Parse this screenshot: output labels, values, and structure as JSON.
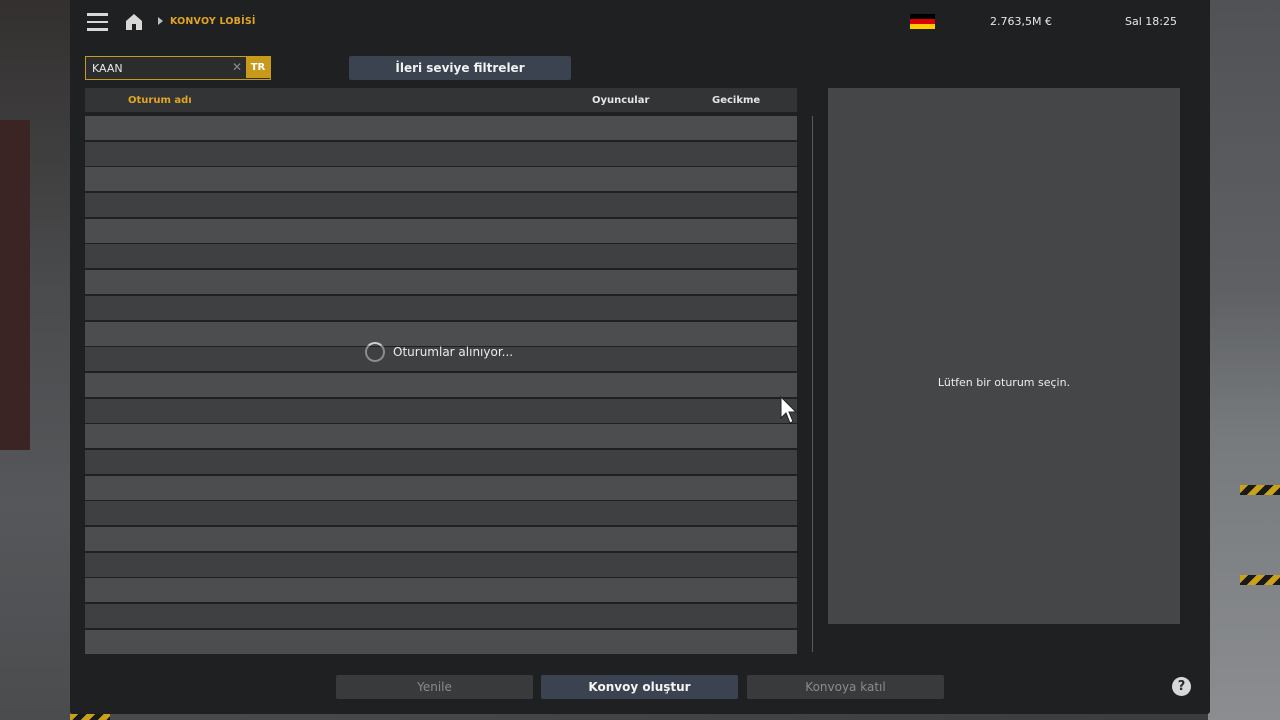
{
  "topbar": {
    "breadcrumb": "KONVOY LOBİSİ",
    "money": "2.763,5M  €",
    "clock": "Sal 18:25",
    "flag": [
      "#000000",
      "#dd0000",
      "#ffce00"
    ]
  },
  "filters": {
    "search_value": "KAAN",
    "language": "TR",
    "advanced_label": "İleri seviye filtreler"
  },
  "table": {
    "columns": [
      "Oturum adı",
      "Oyuncular",
      "Gecikme"
    ],
    "row_count": 21
  },
  "loading_text": "Oturumlar alınıyor...",
  "detail_text": "Lütfen bir oturum seçin.",
  "buttons": {
    "refresh": "Yenile",
    "create": "Konvoy oluştur",
    "join": "Konvoya katıl",
    "help": "?"
  },
  "colors": {
    "accent": "#e2a524",
    "panel": "#1f2021",
    "primary_button": "#3c4350"
  }
}
